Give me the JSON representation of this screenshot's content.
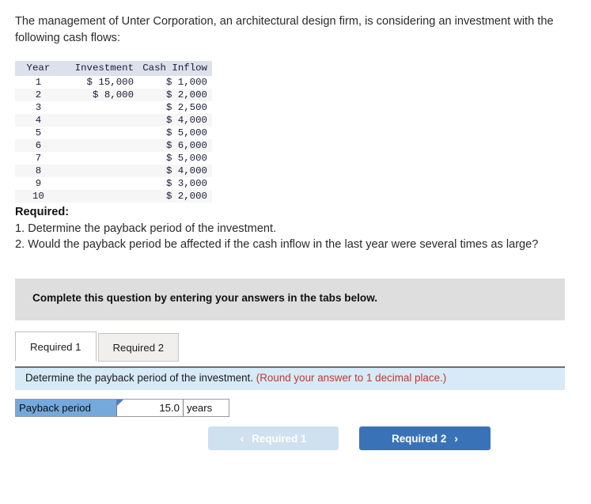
{
  "intro": {
    "text": "The management of Unter Corporation, an architectural design firm, is considering an investment with the following cash flows:"
  },
  "cash_flow_table": {
    "headers": [
      "Year",
      "Investment",
      "Cash Inflow"
    ],
    "rows": [
      {
        "year": "1",
        "investment": "$ 15,000",
        "cash_inflow": "$ 1,000"
      },
      {
        "year": "2",
        "investment": "$ 8,000",
        "cash_inflow": "$ 2,000"
      },
      {
        "year": "3",
        "investment": "",
        "cash_inflow": "$ 2,500"
      },
      {
        "year": "4",
        "investment": "",
        "cash_inflow": "$ 4,000"
      },
      {
        "year": "5",
        "investment": "",
        "cash_inflow": "$ 5,000"
      },
      {
        "year": "6",
        "investment": "",
        "cash_inflow": "$ 6,000"
      },
      {
        "year": "7",
        "investment": "",
        "cash_inflow": "$ 5,000"
      },
      {
        "year": "8",
        "investment": "",
        "cash_inflow": "$ 4,000"
      },
      {
        "year": "9",
        "investment": "",
        "cash_inflow": "$ 3,000"
      },
      {
        "year": "10",
        "investment": "",
        "cash_inflow": "$ 2,000"
      }
    ]
  },
  "required": {
    "heading": "Required:",
    "item1": "1. Determine the payback period of the investment.",
    "item2": "2. Would the payback period be affected if the cash inflow in the last year were several times as large?"
  },
  "gray_banner": {
    "text": "Complete this question by entering your answers in the tabs below."
  },
  "tabs": [
    {
      "label": "Required 1",
      "active": true
    },
    {
      "label": "Required 2",
      "active": false
    }
  ],
  "blue_bar": {
    "text": "Determine the payback period of the investment.",
    "hint": "(Round your answer to 1 decimal place.)"
  },
  "answer_row": {
    "label": "Payback period",
    "value": "15.0",
    "unit": "years"
  },
  "nav_buttons": {
    "prev": {
      "label": "Required 1",
      "chevron": "chevron-left-icon",
      "glyph": "‹"
    },
    "next": {
      "label": "Required 2",
      "chevron": "chevron-right-icon",
      "glyph": "›"
    }
  },
  "colors": {
    "table_header_bg": "#dde1ec",
    "table_stripe_bg": "#f6f6f6",
    "gray_banner_bg": "#dedede",
    "blue_bar_bg": "#d7eaf8",
    "hint_red": "#c0392b",
    "answer_label_bg": "#74a9dd",
    "next_button_bg": "#3a72b8",
    "prev_button_bg": "#cfe0ef"
  }
}
